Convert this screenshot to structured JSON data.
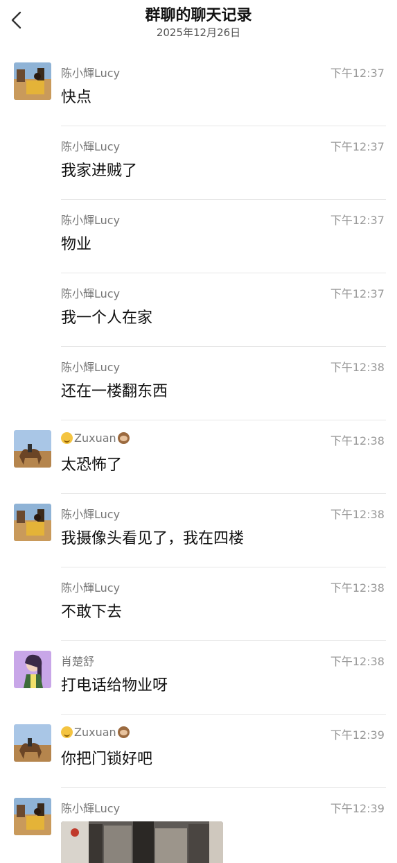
{
  "header": {
    "title": "群聊的聊天记录",
    "date": "2025年12月26日"
  },
  "messages": [
    {
      "sender": "陈小輝Lucy",
      "avatar": "desert-photo-avatar",
      "time": "下午12:37",
      "text": "快点"
    },
    {
      "sender": "陈小輝Lucy",
      "avatar": "",
      "time": "下午12:37",
      "text": "我家进贼了"
    },
    {
      "sender": "陈小輝Lucy",
      "avatar": "",
      "time": "下午12:37",
      "text": "物业"
    },
    {
      "sender": "陈小輝Lucy",
      "avatar": "",
      "time": "下午12:37",
      "text": "我一个人在家"
    },
    {
      "sender": "陈小輝Lucy",
      "avatar": "",
      "time": "下午12:38",
      "text": "还在一楼翻东西"
    },
    {
      "sender": "Zuxuan",
      "avatar": "camel-photo-avatar",
      "time": "下午12:38",
      "text": "太恐怖了"
    },
    {
      "sender": "陈小輝Lucy",
      "avatar": "desert-photo-avatar",
      "time": "下午12:38",
      "text": "我摄像头看见了，我在四楼"
    },
    {
      "sender": "陈小輝Lucy",
      "avatar": "",
      "time": "下午12:38",
      "text": "不敢下去"
    },
    {
      "sender": "肖楚舒",
      "avatar": "illustrated-girl-avatar",
      "time": "下午12:38",
      "text": "打电话给物业呀"
    },
    {
      "sender": "Zuxuan",
      "avatar": "camel-photo-avatar",
      "time": "下午12:39",
      "text": "你把门锁好吧"
    },
    {
      "sender": "陈小輝Lucy",
      "avatar": "desert-photo-avatar",
      "time": "下午12:39",
      "text": ""
    }
  ],
  "colors": {
    "background": "#ffffff",
    "sender": "#777777",
    "time": "#999999",
    "divider": "#e6e6e6"
  }
}
